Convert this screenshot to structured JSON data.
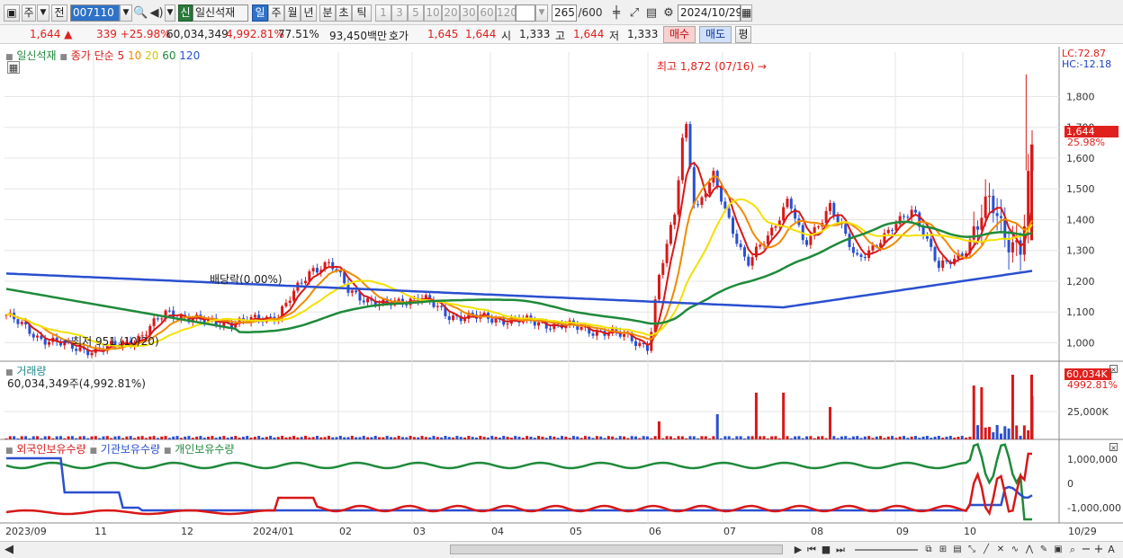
{
  "toolbar": {
    "type": "주",
    "prev": "전",
    "code": "007110",
    "badge": "신",
    "name": "일신석재",
    "periods": [
      "일",
      "주",
      "월",
      "년",
      "분",
      "초",
      "틱"
    ],
    "selected_period": "일",
    "intervals": [
      "1",
      "3",
      "5",
      "10",
      "20",
      "30",
      "60",
      "120"
    ],
    "count": "265",
    "count_max": "/600",
    "date": "2024/10/29"
  },
  "quote": {
    "price": "1,644 ▲",
    "change": "339 +25.98%",
    "volume": "60,034,349",
    "vol_pct": "4,992.81%",
    "turnover": "77.51%",
    "amount": "93,450백만",
    "ask_label": "호가",
    "ask1": "1,645",
    "ask2": "1,644",
    "open_label": "시",
    "open": "1,333",
    "high_label": "고",
    "high": "1,644",
    "low_label": "저",
    "low": "1,333",
    "buy": "매수",
    "sell": "매도",
    "eval": "평"
  },
  "price_panel": {
    "title": "일신석재",
    "ma_label": "종가 단순",
    "ma_periods": [
      "5",
      "10",
      "20",
      "60",
      "120"
    ],
    "ma_colors": [
      "#d81818",
      "#f08a00",
      "#f3e000",
      "#1e8a3a",
      "#2a4fd0"
    ],
    "high_note": "최고 1,872 (07/16)",
    "low_note": "최저 951 (10/20)",
    "dividend_note": "배당락(0.00%)",
    "lc": "LC:72.87",
    "hc": "HC:-12.18",
    "last_price": "1,644",
    "last_pct": "25.98%",
    "y_ticks": [
      "1,800",
      "1,700",
      "1,600",
      "1,500",
      "1,400",
      "1,300",
      "1,200",
      "1,100",
      "1,000"
    ]
  },
  "volume_panel": {
    "title": "거래량",
    "value": "60,034,349주(4,992.81%)",
    "last": "60,034K",
    "last_pct": "4992.81%",
    "y_tick": "25,000K"
  },
  "holding_panel": {
    "series": [
      "외국인보유수량",
      "기관보유수량",
      "개인보유수량"
    ],
    "colors": [
      "#d81818",
      "#2a4fd0",
      "#1e8a3a"
    ],
    "y_ticks": [
      "1,000,000",
      "0",
      "-1,000,000"
    ]
  },
  "x_axis": [
    "2023/09",
    "11",
    "12",
    "2024/01",
    "02",
    "03",
    "04",
    "05",
    "06",
    "07",
    "08",
    "09",
    "10",
    "10/29"
  ],
  "chart_data": {
    "type": "line",
    "title": "일신석재",
    "x": [
      "2023/09",
      "11",
      "12",
      "2024/01",
      "02",
      "03",
      "04",
      "05",
      "06",
      "07",
      "08",
      "09",
      "10",
      "10/29"
    ],
    "series": [
      {
        "name": "종가 (approx.)",
        "values": [
          1080,
          970,
          1090,
          1060,
          1250,
          1120,
          1070,
          1050,
          1000,
          1050,
          1350,
          1400,
          1350,
          1644
        ]
      },
      {
        "name": "120",
        "values": [
          1230,
          1180,
          1140,
          1120,
          1100,
          1100,
          1100,
          1100,
          1090,
          1090,
          1130,
          1170,
          1220,
          1250
        ]
      }
    ],
    "ylim": [
      940,
      1880
    ],
    "high": 1872,
    "low": 951
  }
}
